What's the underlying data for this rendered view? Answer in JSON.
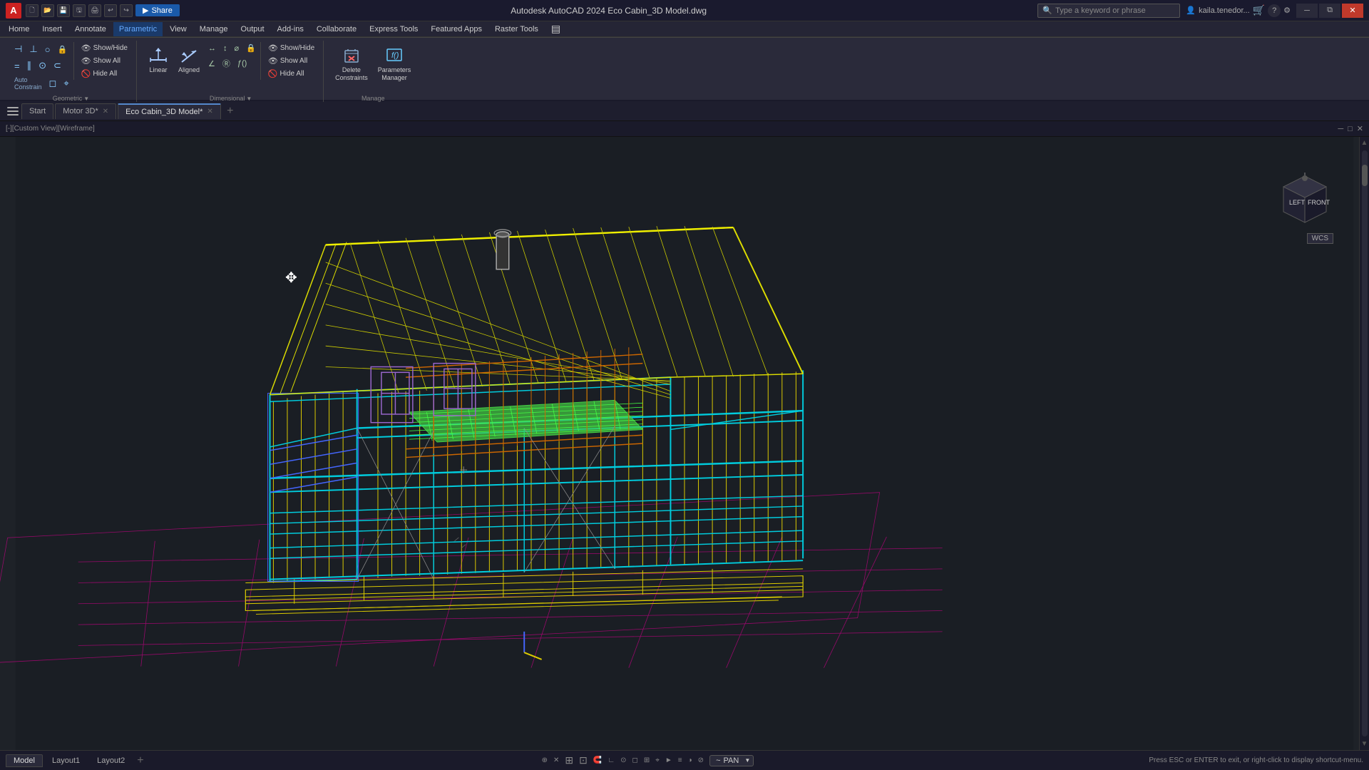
{
  "app": {
    "name": "Autodesk AutoCAD 2024",
    "file": "Eco Cabin_3D Model.dwg",
    "title": "Autodesk AutoCAD 2024  Eco Cabin_3D Model.dwg",
    "logo": "A"
  },
  "titlebar": {
    "icons": [
      "new",
      "open",
      "save",
      "saveas",
      "print",
      "undo",
      "redo"
    ],
    "share_label": "Share",
    "search_placeholder": "Type a keyword or phrase",
    "user": "kaila.tenedor...",
    "window_controls": [
      "minimize",
      "restore",
      "close"
    ]
  },
  "menu": {
    "items": [
      "Home",
      "Insert",
      "Annotate",
      "Parametric",
      "View",
      "Manage",
      "Output",
      "Add-ins",
      "Collaborate",
      "Express Tools",
      "Featured Apps",
      "Raster Tools"
    ]
  },
  "ribbon": {
    "active_tab": "Parametric",
    "groups": {
      "geometric": {
        "title": "Geometric",
        "show_hide": "Show/Hide",
        "show_all": "Show All",
        "hide_all": "Hide All"
      },
      "dimensional": {
        "title": "Dimensional",
        "show_hide": "Show/Hide",
        "show_all": "Show All",
        "hide_all": "Hide All",
        "linear_label": "Linear",
        "aligned_label": "Aligned"
      },
      "manage": {
        "title": "Manage",
        "delete_label": "Delete\nConstraints",
        "params_label": "Parameters\nManager"
      }
    }
  },
  "doc_tabs": {
    "hamburger": "≡",
    "tabs": [
      {
        "label": "Start",
        "active": false,
        "closeable": false
      },
      {
        "label": "Motor 3D*",
        "active": false,
        "closeable": true
      },
      {
        "label": "Eco Cabin_3D Model*",
        "active": true,
        "closeable": true
      }
    ],
    "add_label": "+"
  },
  "viewport": {
    "label": "[-][Custom View][Wireframe]",
    "controls": [
      "minimize",
      "maximize",
      "close"
    ]
  },
  "viewcube": {
    "left": "LEFT",
    "front": "FRONT"
  },
  "wcs": {
    "label": "WCS"
  },
  "status_bar": {
    "layout_tabs": [
      "Model",
      "Layout1",
      "Layout2"
    ],
    "active_layout": "Model",
    "add_label": "+",
    "pan_label": "PAN",
    "status_message": "Press ESC or ENTER to exit, or right-click to display shortcut-menu.",
    "tools": [
      "model-icon",
      "grid-icon",
      "snap-icon",
      "ortho-icon",
      "polar-icon",
      "osnap-icon",
      "otrack-icon",
      "ducs-icon",
      "dyn-icon",
      "lineweight-icon",
      "transparency-icon",
      "qprops-icon",
      "selection-icon",
      "annotation-icon",
      "workspace-icon",
      "units-icon",
      "lock-icon",
      "isolate-icon",
      "custui-icon"
    ]
  },
  "colors": {
    "background": "#1e2228",
    "accent": "#5588cc",
    "cyan_lines": "#00ccdd",
    "yellow_lines": "#ddcc00",
    "green_floor": "#44cc44",
    "magenta_grid": "#cc0088",
    "orange_lines": "#cc6600",
    "blue_lines": "#4466ff",
    "ui_dark": "#1a1a2e",
    "ui_mid": "#2a2a3a"
  }
}
